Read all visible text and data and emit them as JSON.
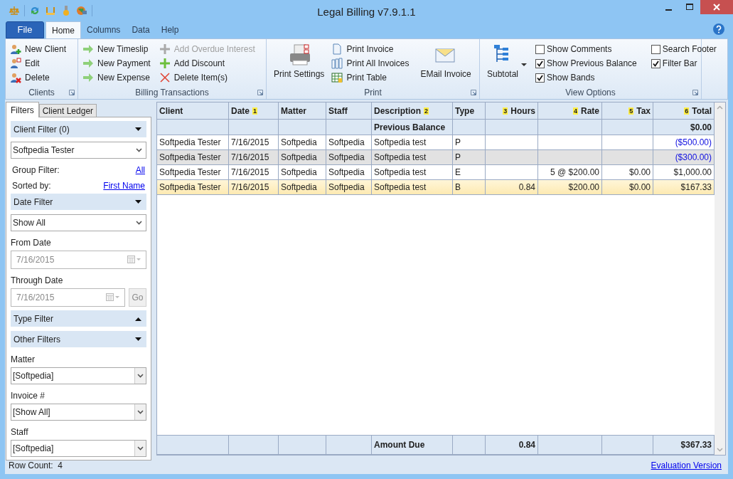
{
  "window": {
    "title": "Legal Billing v7.9.1.1"
  },
  "ribbon": {
    "file_label": "File",
    "tabs": [
      {
        "label": "Home",
        "selected": true
      },
      {
        "label": "Columns",
        "selected": false
      },
      {
        "label": "Data",
        "selected": false
      },
      {
        "label": "Help",
        "selected": false
      }
    ],
    "groups": [
      {
        "title": "Clients",
        "items": [
          {
            "kind": "small",
            "label": "New Client",
            "disabled": false
          },
          {
            "kind": "small",
            "label": "Edit",
            "disabled": false
          },
          {
            "kind": "small",
            "label": "Delete",
            "disabled": false
          }
        ]
      },
      {
        "title": "Billing Transactions",
        "items": [
          {
            "kind": "small",
            "label": "New Timeslip",
            "disabled": false
          },
          {
            "kind": "small",
            "label": "New Payment",
            "disabled": false
          },
          {
            "kind": "small",
            "label": "New Expense",
            "disabled": false
          },
          {
            "kind": "small",
            "label": "Add Overdue Interest",
            "disabled": true
          },
          {
            "kind": "small",
            "label": "Add Discount",
            "disabled": false
          },
          {
            "kind": "small",
            "label": "Delete Item(s)",
            "disabled": false
          }
        ]
      },
      {
        "title": "Print",
        "items": [
          {
            "kind": "large",
            "label": "Print Settings",
            "disabled": false
          },
          {
            "kind": "small",
            "label": "Print Invoice",
            "disabled": false
          },
          {
            "kind": "small",
            "label": "Print All Invoices",
            "disabled": false
          },
          {
            "kind": "small",
            "label": "Print Table",
            "disabled": false
          },
          {
            "kind": "large",
            "label": "EMail Invoice",
            "disabled": false
          }
        ]
      },
      {
        "title": "View Options",
        "items": [
          {
            "kind": "large",
            "label": "Subtotal",
            "disabled": false
          },
          {
            "kind": "checkbox",
            "label": "Show Comments",
            "checked": false
          },
          {
            "kind": "checkbox",
            "label": "Show Previous Balance",
            "checked": true
          },
          {
            "kind": "checkbox",
            "label": "Show Bands",
            "checked": true
          },
          {
            "kind": "checkbox",
            "label": "Search Footer",
            "checked": false
          },
          {
            "kind": "checkbox",
            "label": "Filter Bar",
            "checked": true
          }
        ]
      }
    ]
  },
  "left_panel": {
    "tabs": [
      {
        "label": "Filters",
        "selected": true
      },
      {
        "label": "Client Ledger",
        "selected": false
      }
    ],
    "items": [
      {
        "kind": "header",
        "label": "Client Filter (0)",
        "expanded": true
      },
      {
        "kind": "select",
        "value": "Softpedia Tester"
      },
      {
        "kind": "link_row",
        "label": "Group Filter:",
        "link": "All"
      },
      {
        "kind": "link_row",
        "label": "Sorted by:",
        "link": "First Name"
      },
      {
        "kind": "header",
        "label": "Date Filter",
        "expanded": true
      },
      {
        "kind": "select",
        "value": "Show All"
      },
      {
        "kind": "label",
        "label": "From Date"
      },
      {
        "kind": "date",
        "value": "7/16/2015",
        "disabled": true
      },
      {
        "kind": "label",
        "label": "Through Date"
      },
      {
        "kind": "date_go",
        "value": "7/16/2015",
        "button": "Go",
        "disabled": true
      },
      {
        "kind": "header",
        "label": "Type Filter",
        "expanded": false
      },
      {
        "kind": "header",
        "label": "Other Filters",
        "expanded": true
      },
      {
        "kind": "label",
        "label": "Matter"
      },
      {
        "kind": "combo",
        "value": "[Softpedia]"
      },
      {
        "kind": "label",
        "label": "Invoice #"
      },
      {
        "kind": "combo",
        "value": "[Show All]"
      },
      {
        "kind": "label",
        "label": "Staff"
      },
      {
        "kind": "combo",
        "value": "[Softpedia]"
      }
    ]
  },
  "table": {
    "columns": [
      {
        "label": "Client"
      },
      {
        "label": "Date",
        "sort_order": "1"
      },
      {
        "label": "Matter"
      },
      {
        "label": "Staff"
      },
      {
        "label": "Description",
        "sort_order": "2"
      },
      {
        "label": "Type"
      },
      {
        "label": "Hours",
        "sort_order": "3"
      },
      {
        "label": "Rate",
        "sort_order": "4"
      },
      {
        "label": "Tax",
        "sort_order": "5"
      },
      {
        "label": "Total",
        "sort_order": "6"
      }
    ],
    "previous_balance": {
      "label": "Previous Balance",
      "total": "$0.00"
    },
    "rows": [
      {
        "cells": [
          "Softpedia Tester",
          "7/16/2015",
          "Softpedia",
          "Softpedia",
          "Softpedia test",
          "P",
          null,
          null,
          null,
          "($500.00)"
        ],
        "credit": true,
        "selected": false
      },
      {
        "cells": [
          "Softpedia Tester",
          "7/16/2015",
          "Softpedia",
          "Softpedia",
          "Softpedia test",
          "P",
          null,
          null,
          null,
          "($300.00)"
        ],
        "credit": true,
        "selected": false
      },
      {
        "cells": [
          "Softpedia Tester",
          "7/16/2015",
          "Softpedia",
          "Softpedia",
          "Softpedia test",
          "E",
          null,
          "5 @ $200.00",
          "$0.00",
          "$1,000.00"
        ],
        "credit": false,
        "selected": false
      },
      {
        "cells": [
          "Softpedia Tester",
          "7/16/2015",
          "Softpedia",
          "Softpedia",
          "Softpedia test",
          "B",
          "0.84",
          "$200.00",
          "$0.00",
          "$167.33"
        ],
        "credit": false,
        "selected": true
      }
    ],
    "footer": {
      "label": "Amount Due",
      "hours": "0.84",
      "total": "$367.33"
    }
  },
  "status_bar": {
    "row_count": "Row Count:  4",
    "link": "Evaluation Version"
  }
}
